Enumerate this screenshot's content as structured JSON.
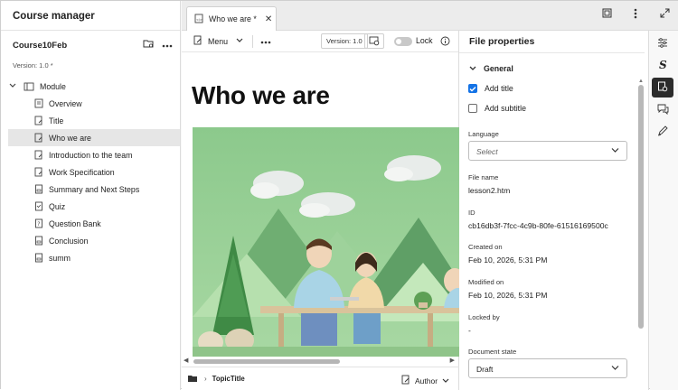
{
  "left_panel": {
    "title": "Course manager",
    "course_name": "Course10Feb",
    "version": "Version: 1.0 *",
    "tree": {
      "root": "Module",
      "items": [
        "Overview",
        "Title",
        "Who we are",
        "Introduction to the team",
        "Work Specification",
        "Summary and Next Steps",
        "Quiz",
        "Question Bank",
        "Conclusion",
        "summ"
      ],
      "selected": "Who we are"
    }
  },
  "tabs": [
    {
      "label": "Who we are *"
    }
  ],
  "toolbar": {
    "menu_label": "Menu",
    "version_badge": "Version: 1.0",
    "lock_label": "Lock"
  },
  "document": {
    "title": "Who we are"
  },
  "statusbar": {
    "topic": "TopicTitle",
    "author": "Author"
  },
  "properties": {
    "title": "File properties",
    "section": "General",
    "add_title": "Add title",
    "add_title_checked": true,
    "add_subtitle": "Add subtitle",
    "add_subtitle_checked": false,
    "language_label": "Language",
    "language_placeholder": "Select",
    "file_name_label": "File name",
    "file_name": "lesson2.htm",
    "id_label": "ID",
    "id": "cb16db3f-7fcc-4c9b-80fe-61516169500c",
    "created_label": "Created on",
    "created": "Feb 10, 2026, 5:31 PM",
    "modified_label": "Modified on",
    "modified": "Feb 10, 2026, 5:31 PM",
    "locked_label": "Locked by",
    "locked": "-",
    "state_label": "Document state",
    "state": "Draft"
  },
  "colors": {
    "accent": "#1473e6",
    "illustration_bg": "#7fbf7a"
  }
}
